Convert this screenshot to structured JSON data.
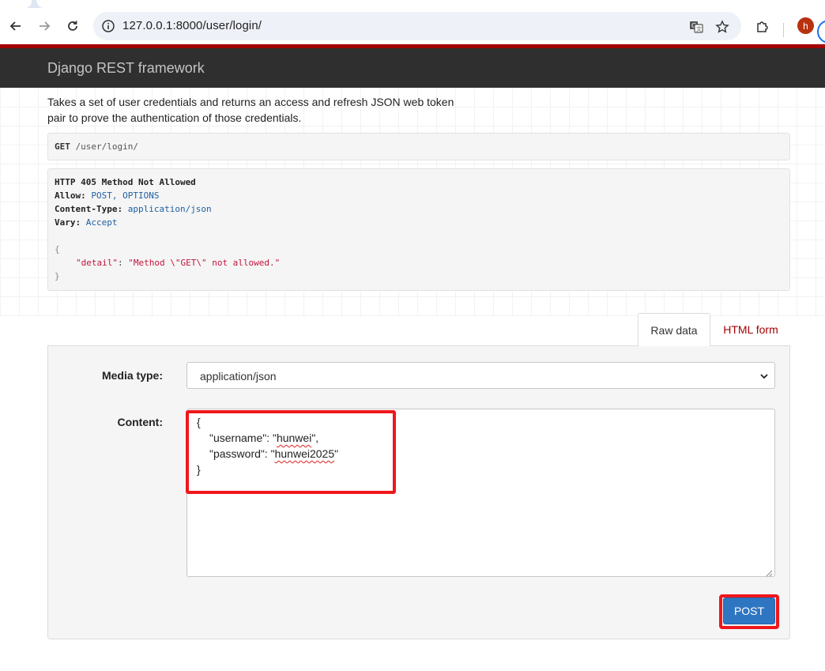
{
  "browser": {
    "url": "127.0.0.1:8000/user/login/",
    "avatar_letter": "h"
  },
  "navbar": {
    "brand": "Django REST framework"
  },
  "view": {
    "description": "Takes a set of user credentials and returns an access and refresh JSON web token pair to prove the authentication of those credentials.",
    "request_method": "GET",
    "request_path": "/user/login/"
  },
  "response": {
    "status": "HTTP 405 Method Not Allowed",
    "allow_label": "Allow:",
    "allow_value": "POST, OPTIONS",
    "content_type_label": "Content-Type:",
    "content_type_value": "application/json",
    "vary_label": "Vary:",
    "vary_value": "Accept",
    "body_open": "{",
    "body_key": "\"detail\"",
    "body_colon": ": ",
    "body_value": "\"Method \\\"GET\\\" not allowed.\"",
    "body_close": "}"
  },
  "tabs": {
    "raw_data": "Raw data",
    "html_form": "HTML form"
  },
  "form": {
    "media_type_label": "Media type:",
    "media_type_value": "application/json",
    "content_label": "Content:",
    "content_open": "{",
    "username_key": "\"username\": \"",
    "username_value": "hunwei",
    "username_end": "\",",
    "password_key": "\"password\": \"",
    "password_value": "hunwei2025",
    "password_end": "\"",
    "content_close": "}",
    "submit_label": "POST"
  },
  "colors": {
    "brand_red": "#a30000",
    "navbar_bg": "#2f2f2f",
    "post_button": "#2f76c2",
    "annotation_red": "#f0171b"
  }
}
